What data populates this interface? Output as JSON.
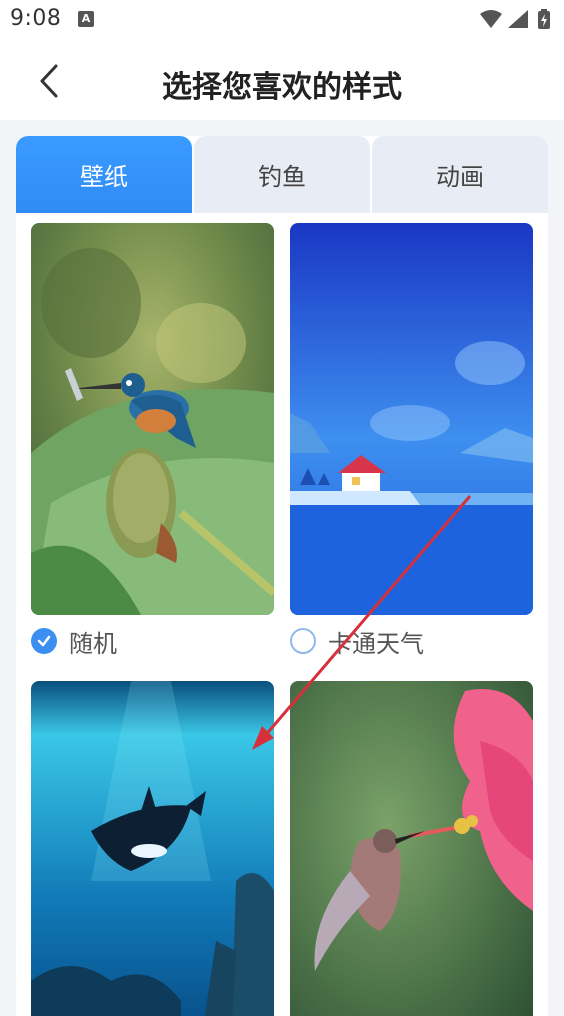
{
  "status_bar": {
    "time": "9:08",
    "notification_icon": "a-badge-icon",
    "icons": [
      "wifi-icon",
      "signal-icon",
      "battery-charging-icon"
    ]
  },
  "header": {
    "back_icon": "chevron-left-icon",
    "title": "选择您喜欢的样式"
  },
  "tabs": [
    {
      "label": "壁纸",
      "active": true
    },
    {
      "label": "钓鱼",
      "active": false
    },
    {
      "label": "动画",
      "active": false
    }
  ],
  "styles": [
    {
      "label": "随机",
      "selected": true,
      "thumbnail": "kingfisher-on-lotus"
    },
    {
      "label": "卡通天气",
      "selected": false,
      "thumbnail": "cartoon-lake-house"
    },
    {
      "thumbnail": "underwater-orca"
    },
    {
      "thumbnail": "hummingbird-hibiscus"
    }
  ],
  "colors": {
    "accent": "#3b8ff0",
    "tab_inactive": "#e8ecf4",
    "annotation_arrow": "#d6303a"
  }
}
